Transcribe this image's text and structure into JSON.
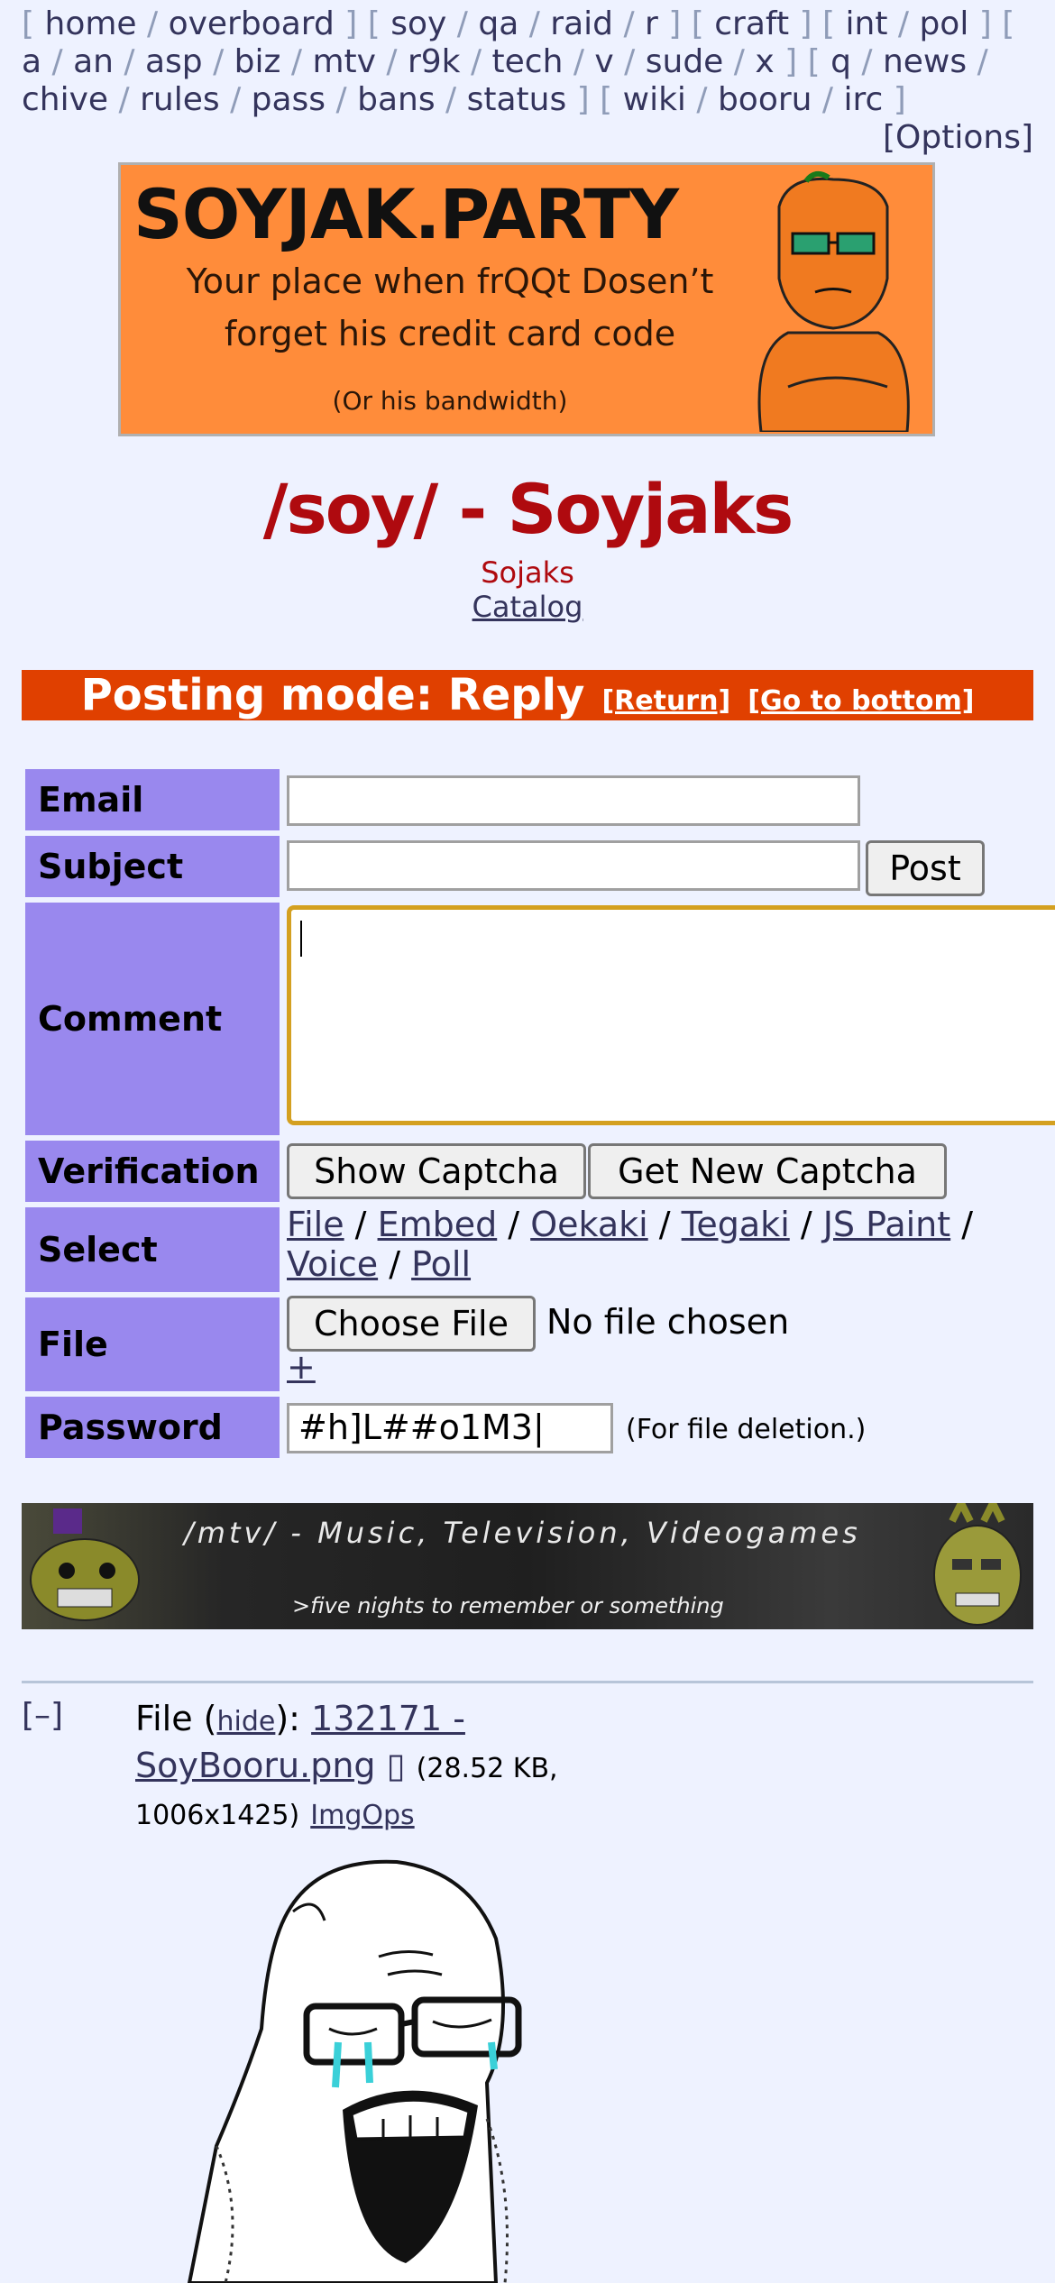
{
  "nav": {
    "items": [
      "home",
      "overboard",
      "soy",
      "qa",
      "raid",
      "r",
      "craft",
      "int",
      "pol",
      "a",
      "an",
      "asp",
      "biz",
      "mtv",
      "r9k",
      "tech",
      "v",
      "sude",
      "x",
      "q",
      "news",
      "chive",
      "rules",
      "pass",
      "bans",
      "status",
      "wiki",
      "booru",
      "irc"
    ],
    "options": "[Options]"
  },
  "banner": {
    "title": "SOYJAK.PARTY",
    "line1": "Your place when frQQt Dosen’t",
    "line2": "forget his credit card code",
    "line3": "(Or his bandwidth)"
  },
  "board": {
    "title": "/soy/ - Soyjaks",
    "subtitle": "Sojaks",
    "catalog": "Catalog"
  },
  "mode": {
    "title": "Posting mode: Reply",
    "return": "[Return]",
    "bottom": "[Go to bottom]"
  },
  "form": {
    "email_label": "Email",
    "subject_label": "Subject",
    "post_button": "Post",
    "comment_label": "Comment",
    "verification_label": "Verification",
    "show_captcha": "Show Captcha",
    "new_captcha": "Get New Captcha",
    "select_label": "Select",
    "select_options": [
      "File",
      "Embed",
      "Oekaki",
      "Tegaki",
      "JS Paint",
      "Voice",
      "Poll"
    ],
    "file_label": "File",
    "choose_file": "Choose File",
    "no_file": "No file chosen",
    "plus": "+",
    "password_label": "Password",
    "password_value": "#h]L##o1M3|",
    "password_note": "(For file deletion.)"
  },
  "ad": {
    "line1": "/mtv/ - Music, Television, Videogames",
    "line2": ">five nights to remember or something"
  },
  "post": {
    "toggle": "[–]",
    "file_prefix": "File (",
    "hide": "hide",
    "file_mid": "):",
    "filename": "132171 - SoyBooru.png",
    "box": "▯",
    "meta": "(28.52 KB, 1006x1425)",
    "imgops": "ImgOps"
  },
  "colors": {
    "background": "#eef2ff",
    "label_bg": "#9988ee",
    "mode_bar": "#e04000",
    "title": "#af0a0f",
    "link": "#34345c",
    "focus": "#d4a020"
  }
}
